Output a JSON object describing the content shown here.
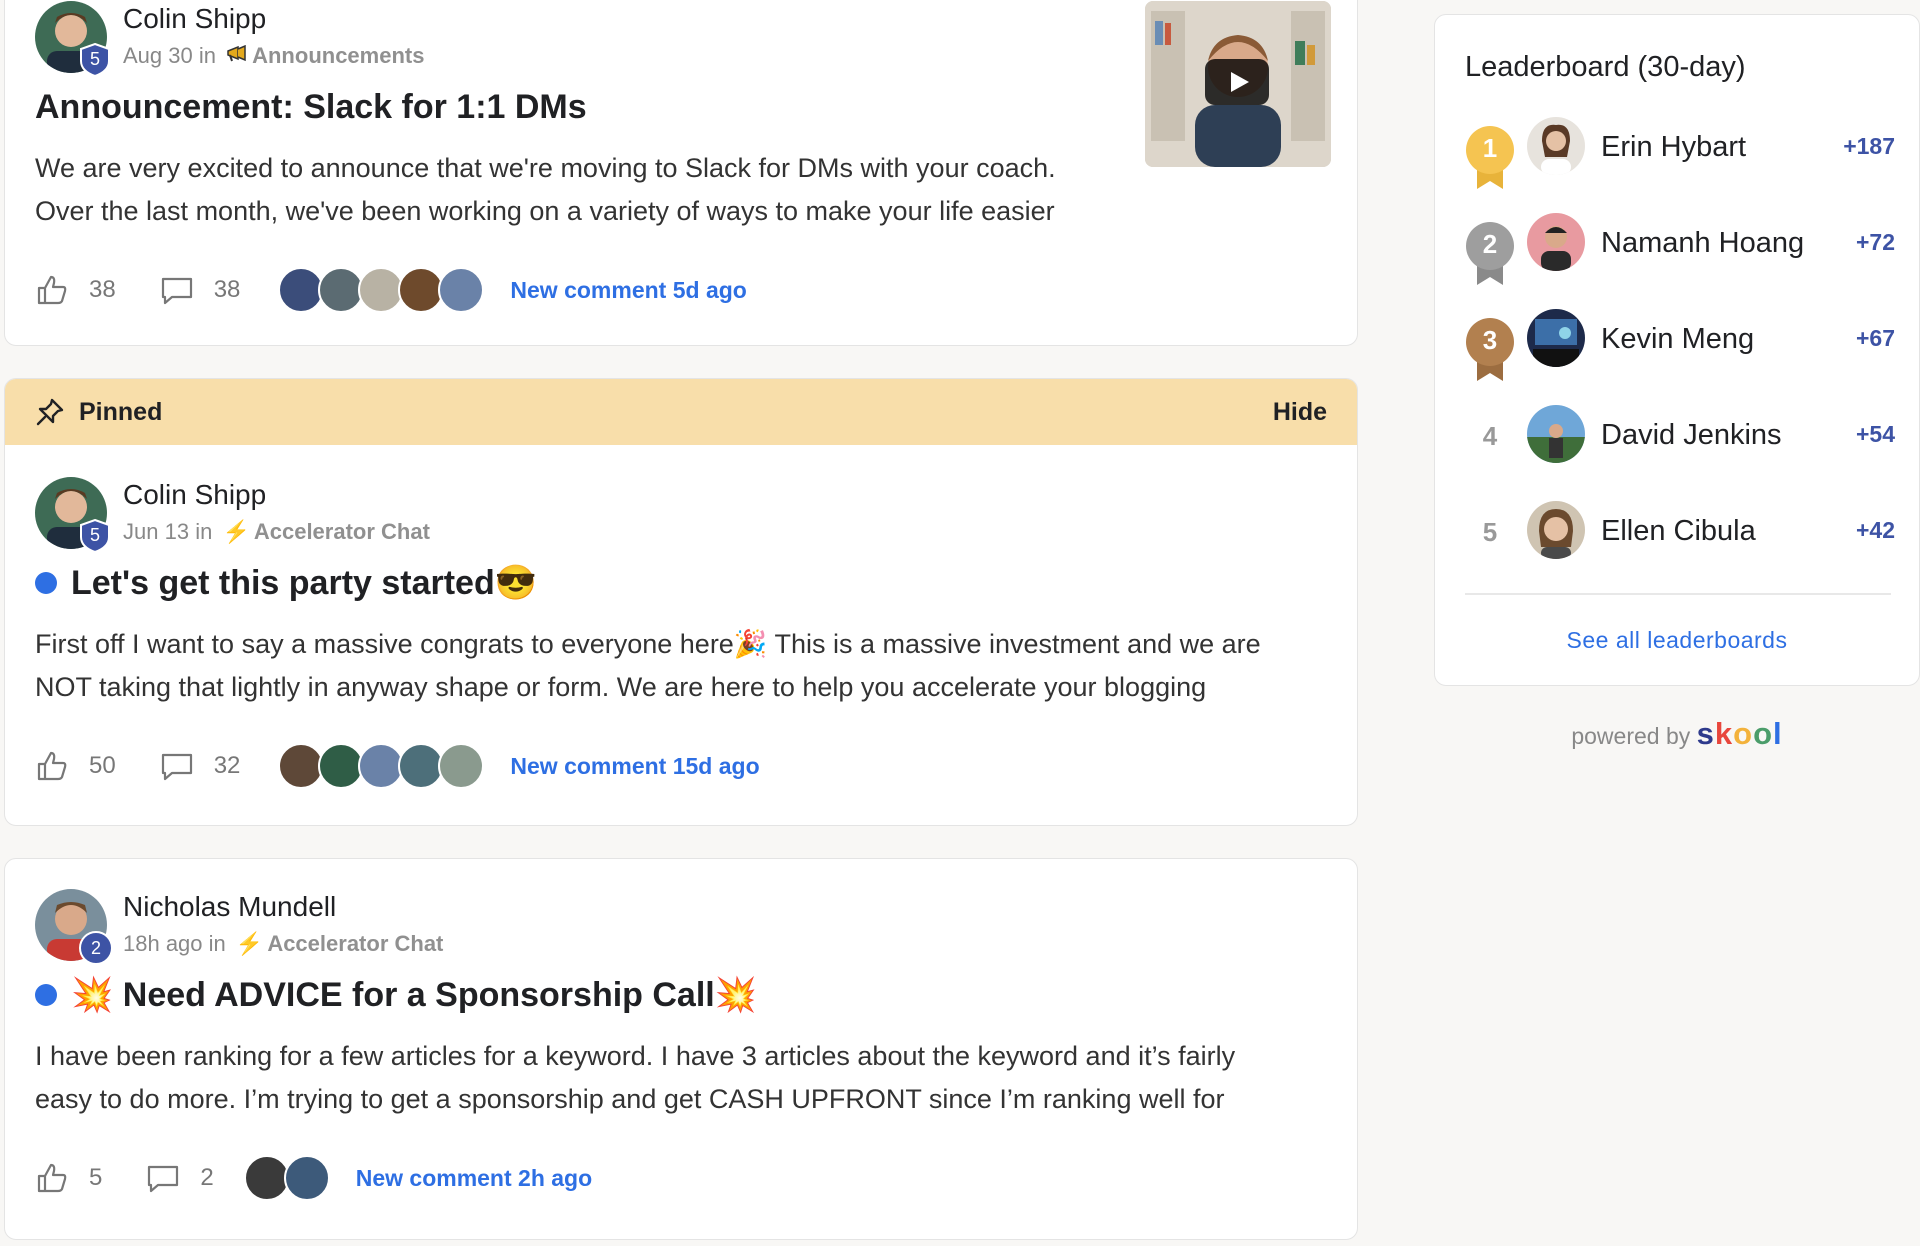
{
  "posts": [
    {
      "author": "Colin Shipp",
      "level": "5",
      "date": "Aug 30",
      "in_word": "in",
      "category_icon": "megaphone-icon",
      "category": "Announcements",
      "title": "Announcement: Slack for 1:1 DMs",
      "body_line1": "We are very excited to announce that we're moving to Slack for DMs with your coach.",
      "body_line2": "Over the last month, we've been working on a variety of ways to make your life easier",
      "likes": "38",
      "comments": "38",
      "new_comment": "New comment 5d ago",
      "has_video": true
    },
    {
      "author": "Colin Shipp",
      "level": "5",
      "date": "Jun 13",
      "in_word": "in",
      "category_icon": "lightning-icon",
      "category": "Accelerator Chat",
      "title": "Let's get this party started😎",
      "body_line1": "First off I want to say a massive congrats to everyone here🎉 This is a massive investment and we are",
      "body_line2": "NOT taking that lightly in anyway shape or form. We are here to help you accelerate your blogging",
      "likes": "50",
      "comments": "32",
      "new_comment": "New comment 15d ago"
    },
    {
      "author": "Nicholas Mundell",
      "level": "2",
      "date": "18h ago",
      "in_word": "in",
      "category_icon": "lightning-icon",
      "category": "Accelerator Chat",
      "title": "💥 Need ADVICE for a Sponsorship Call💥",
      "body_line1": "I have been ranking for a few articles for a keyword. I have 3 articles about the keyword and it’s fairly",
      "body_line2": "easy to do more. I’m trying to get a sponsorship and get CASH UPFRONT since I’m ranking well for",
      "likes": "5",
      "comments": "2",
      "new_comment": "New comment 2h ago"
    }
  ],
  "pinned": {
    "label": "Pinned",
    "hide": "Hide"
  },
  "leaderboard": {
    "title": "Leaderboard (30-day)",
    "entries": [
      {
        "rank": "1",
        "name": "Erin Hybart",
        "points": "+187",
        "medal_color": "#f5c451"
      },
      {
        "rank": "2",
        "name": "Namanh Hoang",
        "points": "+72",
        "medal_color": "#9e9e9e"
      },
      {
        "rank": "3",
        "name": "Kevin Meng",
        "points": "+67",
        "medal_color": "#b2804f"
      },
      {
        "rank": "4",
        "name": "David Jenkins",
        "points": "+54"
      },
      {
        "rank": "5",
        "name": "Ellen Cibula",
        "points": "+42"
      }
    ],
    "see_all": "See all leaderboards"
  },
  "footer": {
    "powered_by": "powered by",
    "brand": "skool",
    "brand_colors": [
      "#2e3a8c",
      "#e8463c",
      "#f3b23b",
      "#4b9d6a",
      "#2e6fe3"
    ]
  },
  "colors": {
    "accent_blue": "#2e6fe3",
    "pinned_bg": "#f8deaa",
    "level_badge": "#3d53a5",
    "points": "#3d53a5"
  }
}
